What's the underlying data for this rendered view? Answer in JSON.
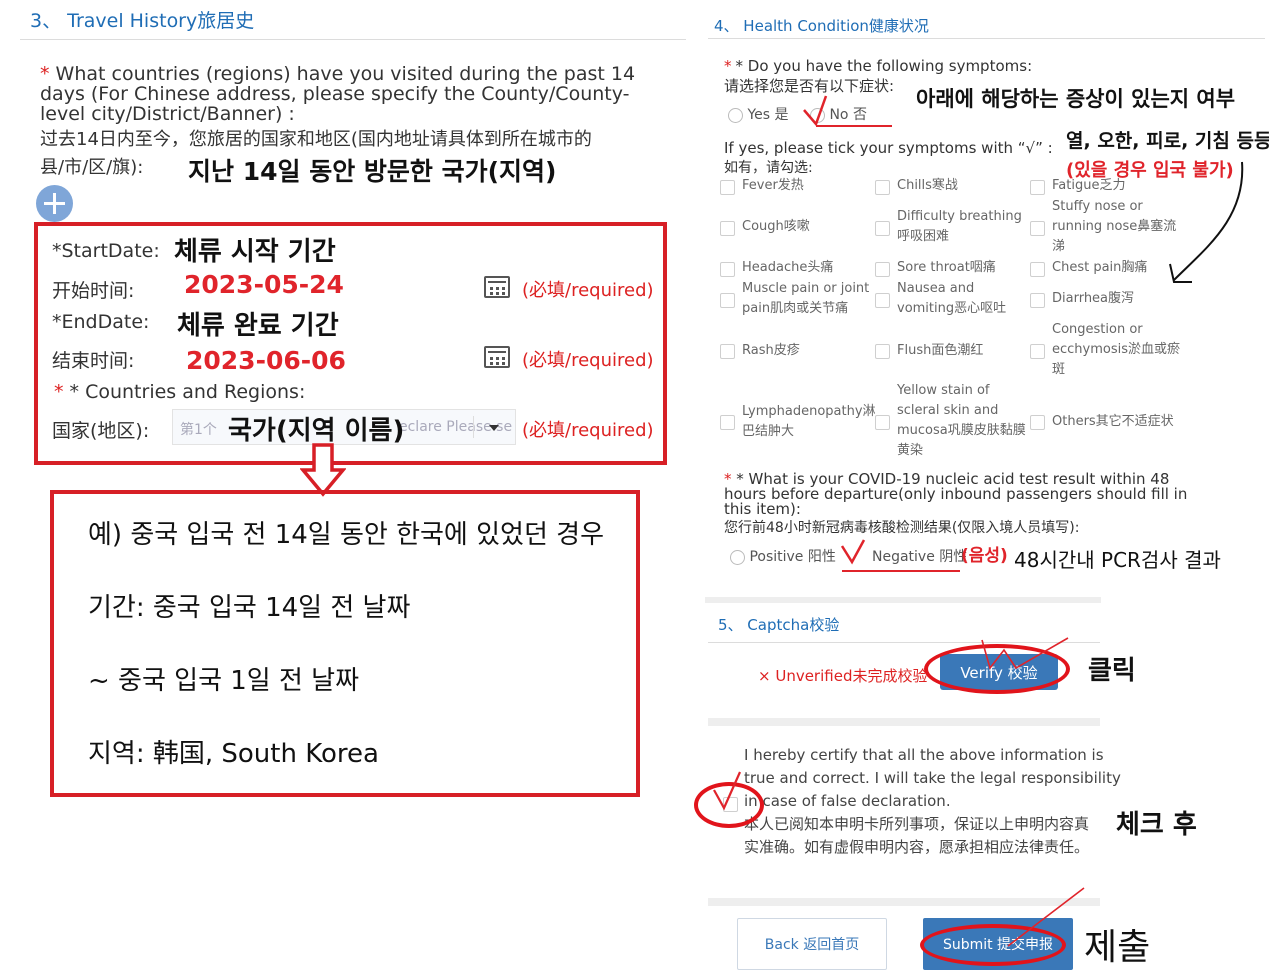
{
  "travel": {
    "title": "3、 Travel History旅居史",
    "question_en_1": "What countries (regions) have you visited during the past 14",
    "question_en_2": "days (For Chinese address, please specify the County/County-",
    "question_en_3": "level city/District/Banner) :",
    "question_cn_1": "过去14日内至今，您旅居的国家和地区(国内地址请具体到所在城市的",
    "question_cn_2": "县/市/区/旗):",
    "annotation_question": "지난 14일 동안 방문한 국가(지역)",
    "start_label": "*StartDate:",
    "start_label_cn": "开始时间:",
    "start_value": "2023-05-24",
    "annotation_start": "체류 시작 기간",
    "end_label": "*EndDate:",
    "end_label_cn": "结束时间:",
    "end_value": "2023-06-06",
    "annotation_end": "체류 완료 기간",
    "required_text": "(必填/required)",
    "countries_label": "* Countries and Regions:",
    "countries_label_cn": "国家(地区):",
    "country_placeholder_1": "第1个",
    "country_placeholder_2": "eclare Please se",
    "annotation_country": "국가(지역 이름)"
  },
  "example": {
    "line1": "예) 중국 입국 전 14일 동안 한국에 있었던 경우",
    "line2": "기간: 중국 입국 14일 전 날짜",
    "line3": "~ 중국 입국 1일 전 날짜",
    "line4": "지역: 韩国, South Korea"
  },
  "health": {
    "title": "4、 Health Condition健康状况",
    "question_en": "* Do you have the following symptoms:",
    "question_cn": "请选择您是否有以下症状:",
    "yes": "Yes 是",
    "no": "No 否",
    "annotation_question": "아래에 해당하는 증상이 있는지 여부",
    "annotation_symptoms": "열, 오한, 피로, 기침 등등",
    "annotation_warning": "(있을 경우 입국 불가)",
    "tick_en": "If yes, please tick your symptoms with “√” :",
    "tick_cn": "如有，请勾选:",
    "symptoms": {
      "fever": "Fever发热",
      "chills": "Chills寒战",
      "fatigue": "Fatigue乏力",
      "stuffy": "Stuffy nose or running nose鼻塞流涕",
      "cough": "Cough咳嗽",
      "breathing": "Difficulty breathing呼吸困难",
      "headache": "Headache头痛",
      "sore": "Sore throat咽痛",
      "chest": "Chest pain胸痛",
      "muscle": "Muscle pain or joint pain肌肉或关节痛",
      "nausea": "Nausea and vomiting恶心呕吐",
      "diarrhea": "Diarrhea腹泻",
      "congestion": "Congestion or ecchymosis淤血或瘀斑",
      "rash": "Rash皮疹",
      "flush": "Flush面色潮红",
      "lymph": "Lymphadenopathy淋巴结肿大",
      "yellow": "Yellow stain of scleral skin and mucosa巩膜皮肤黏膜黄染",
      "others": "Others其它不适症状"
    },
    "test_en_1": "* What is your COVID-19 nucleic acid test result within 48",
    "test_en_2": "hours before departure(only inbound passengers should fill in",
    "test_en_3": "this item):",
    "test_cn": "您行前48小时新冠病毒核酸检测结果(仅限入境人员填写):",
    "positive": "Positive 阳性",
    "negative": "Negative 阴性",
    "annotation_negative": "(음성)",
    "annotation_test": "48시간내 PCR검사 결과"
  },
  "captcha": {
    "title": "5、 Captcha校验",
    "unverified": "× Unverified未完成校验",
    "verify_button": "Verify 校验",
    "annotation_click": "클릭"
  },
  "certify": {
    "line1": "I hereby certify that all the above information is",
    "line2": "true and correct. I will take the legal responsibility",
    "line3": "in case of false declaration.",
    "line4": "本人已阅知本申明卡所列事项，保证以上申明内容真",
    "line5": "实准确。如有虚假申明内容，愿承担相应法律责任。",
    "annotation_check": "체크 후"
  },
  "footer": {
    "back_button": "Back 返回首页",
    "submit_button": "Submit 提交申报",
    "annotation_submit": "제출"
  },
  "colors": {
    "accent_blue": "#1f6db5",
    "button_blue": "#3a78b8",
    "annotation_red": "#e0242b"
  }
}
